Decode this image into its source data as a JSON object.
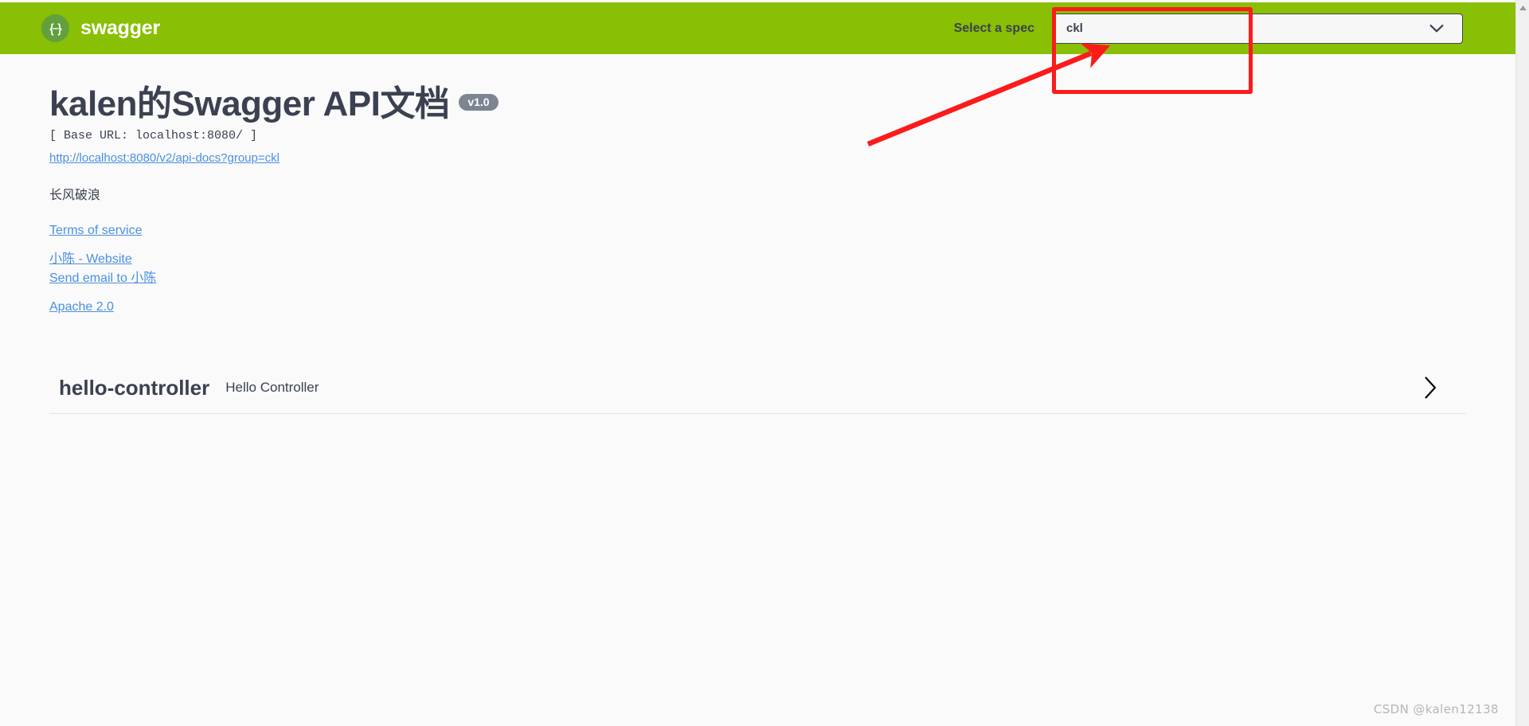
{
  "topbar": {
    "logo_text": "swagger",
    "logo_icon": "swagger-braces-icon",
    "select_label": "Select a spec",
    "spec_selected": "ckl",
    "spec_options": [
      "ckl"
    ],
    "chevron_icon": "chevron-down-icon",
    "bg_color": "#89bf04"
  },
  "info": {
    "title": "kalen的Swagger API文档",
    "version_badge": "v1.0",
    "base_url": "[ Base URL: localhost:8080/ ]",
    "api_docs_url": "http://localhost:8080/v2/api-docs?group=ckl",
    "description": "长风破浪",
    "terms_of_service": "Terms of service",
    "contact_website": "小陈 - Website",
    "contact_email": "Send email to 小陈",
    "license": "Apache 2.0",
    "link_color": "#4a90e2"
  },
  "operations": {
    "tags": [
      {
        "name": "hello-controller",
        "description": "Hello Controller",
        "expand_icon": "chevron-right-icon",
        "expanded": false
      }
    ]
  },
  "annotations": {
    "highlight_color": "#fb1b1b",
    "box_target": "spec-select",
    "arrow_points_to": "spec-select"
  },
  "watermark": {
    "text": "CSDN @kalen12138"
  }
}
